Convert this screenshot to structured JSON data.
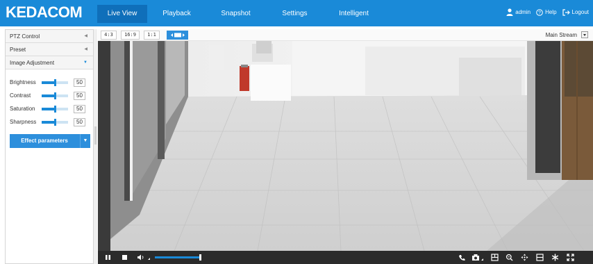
{
  "brand": "KEDACOM",
  "nav": [
    {
      "label": "Live View",
      "active": true
    },
    {
      "label": "Playback",
      "active": false
    },
    {
      "label": "Snapshot",
      "active": false
    },
    {
      "label": "Settings",
      "active": false
    },
    {
      "label": "Intelligent",
      "active": false
    }
  ],
  "user": {
    "name": "admin",
    "help": "Help",
    "logout": "Logout"
  },
  "panel": {
    "sections": [
      "PTZ Control",
      "Preset",
      "Image Adjustment"
    ],
    "expanded": "Image Adjustment",
    "adjustments": [
      {
        "label": "Brightness",
        "value": "50"
      },
      {
        "label": "Contrast",
        "value": "50"
      },
      {
        "label": "Saturation",
        "value": "50"
      },
      {
        "label": "Sharpness",
        "value": "50"
      }
    ],
    "effect_button": "Effect parameters"
  },
  "toolbar": {
    "ratios": [
      {
        "label": "4:3",
        "active": false
      },
      {
        "label": "16:9",
        "active": false
      },
      {
        "label": "1:1",
        "active": false
      }
    ],
    "fit_icon": "fit-window-icon",
    "stream": "Main Stream"
  },
  "playback": {
    "volume_percent": 100,
    "left_icons": [
      "pause-icon",
      "stop-icon",
      "volume-icon"
    ],
    "right_icons": [
      "phone-icon",
      "snapshot-icon",
      "record-icon",
      "zoom-icon",
      "ptz-move-icon",
      "split-icon",
      "star-icon",
      "fullscreen-icon"
    ]
  },
  "colors": {
    "brand_blue": "#1a8ad8",
    "nav_active": "#0f6fba",
    "control_bar": "#2b2b2b"
  }
}
